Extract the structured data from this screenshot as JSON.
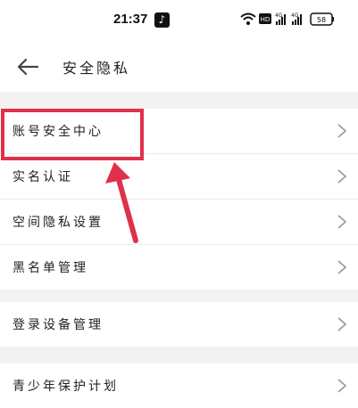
{
  "status_bar": {
    "time": "21:37",
    "app_badge_icon": "tiktok-icon",
    "battery": "58",
    "network_labels": [
      "HD",
      "4G",
      "4G"
    ]
  },
  "header": {
    "back_icon": "back-arrow-icon",
    "title": "安全隐私"
  },
  "groups": [
    {
      "items": [
        {
          "label": "账号安全中心",
          "icon": "chevron-right-icon"
        },
        {
          "label": "实名认证",
          "icon": "chevron-right-icon"
        },
        {
          "label": "空间隐私设置",
          "icon": "chevron-right-icon"
        },
        {
          "label": "黑名单管理",
          "icon": "chevron-right-icon"
        }
      ]
    },
    {
      "items": [
        {
          "label": "登录设备管理",
          "icon": "chevron-right-icon"
        }
      ]
    },
    {
      "items": [
        {
          "label": "青少年保护计划",
          "icon": "chevron-right-icon"
        }
      ]
    }
  ],
  "annotation": {
    "color": "#e0304a"
  }
}
